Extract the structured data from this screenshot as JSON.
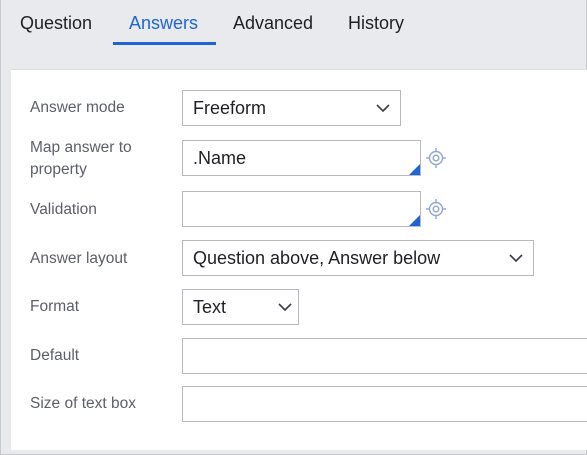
{
  "tabs": [
    {
      "label": "Question",
      "active": false
    },
    {
      "label": "Answers",
      "active": true
    },
    {
      "label": "Advanced",
      "active": false
    },
    {
      "label": "History",
      "active": false
    }
  ],
  "form": {
    "answer_mode": {
      "label": "Answer mode",
      "value": "Freeform"
    },
    "map_answer": {
      "label_line1": "Map answer to",
      "label_line2": "property",
      "value": ".Name"
    },
    "validation": {
      "label": "Validation",
      "value": ""
    },
    "answer_layout": {
      "label": "Answer layout",
      "value": "Question above, Answer below"
    },
    "format": {
      "label": "Format",
      "value": "Text"
    },
    "default": {
      "label": "Default",
      "value": ""
    },
    "size_of_text_box": {
      "label": "Size of text box",
      "value": ""
    }
  },
  "colors": {
    "accent": "#1c64d8",
    "background": "#e9eaee",
    "panel": "#ffffff",
    "label_text": "#5c5f66",
    "icon": "#8fa6d6"
  },
  "icons": {
    "dropdown": "chevron-down-icon",
    "property_picker": "crosshair-target-icon",
    "autocomplete_corner": "corner-triangle-icon"
  }
}
